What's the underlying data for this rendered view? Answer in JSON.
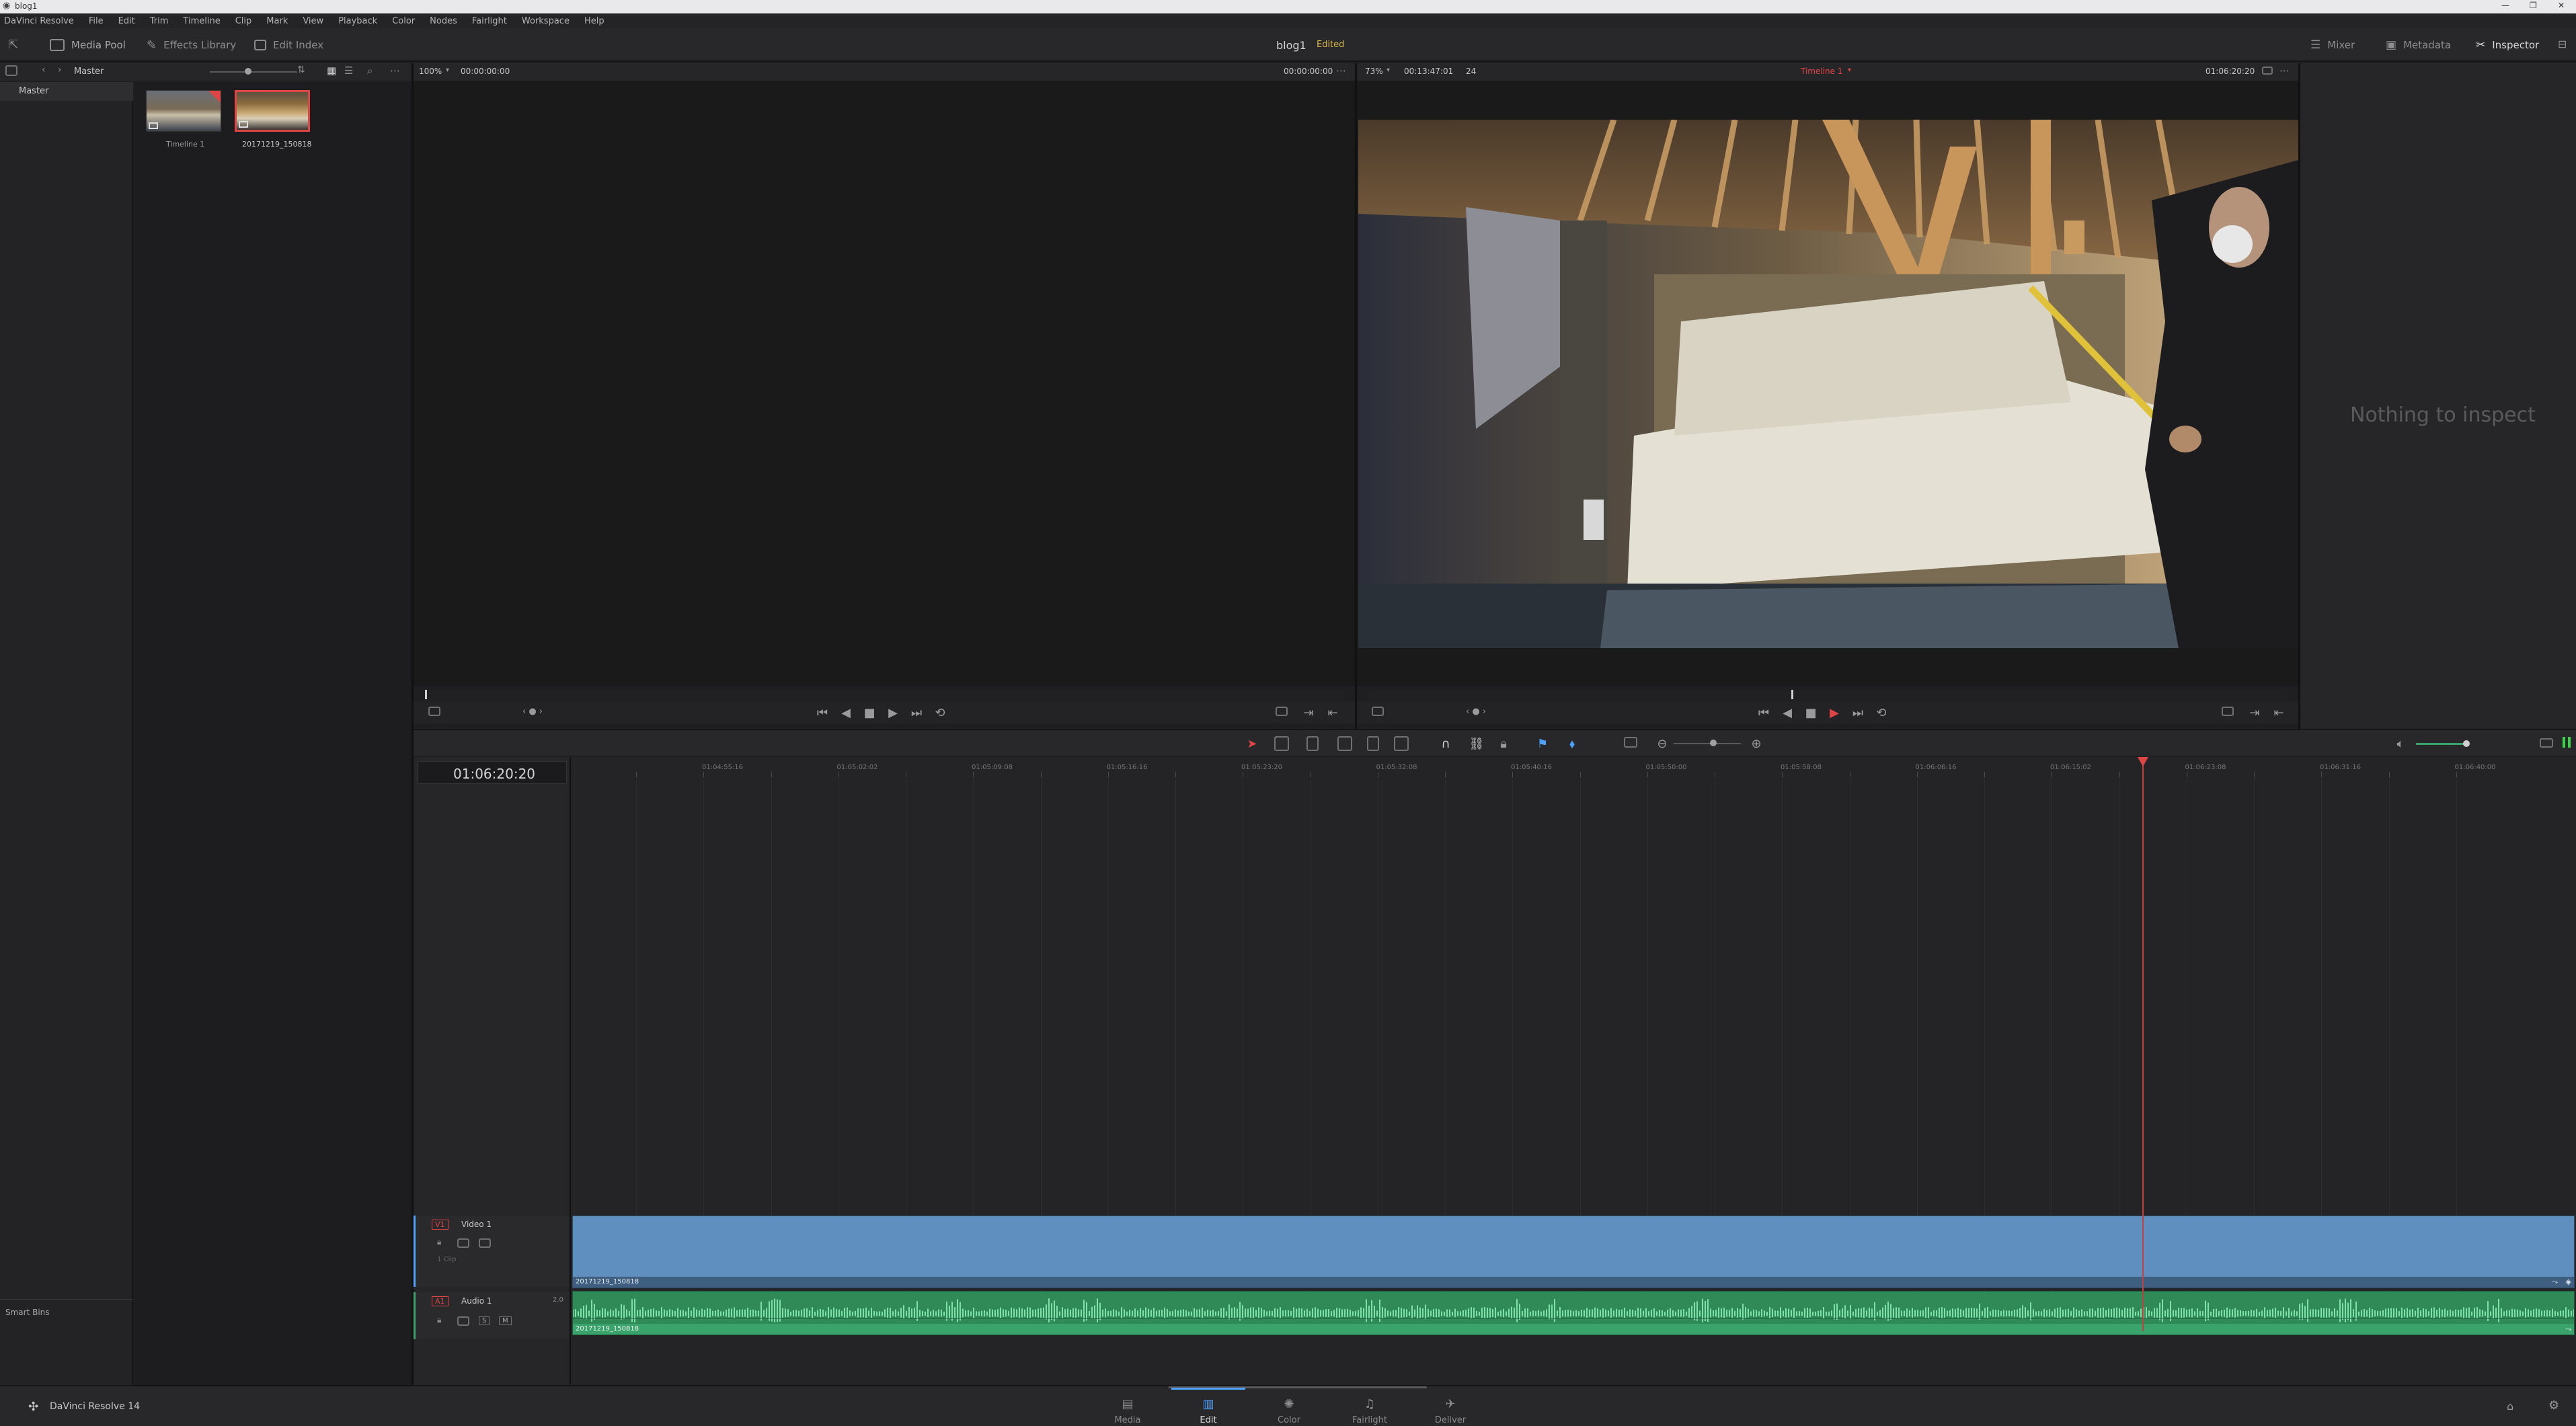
{
  "window": {
    "title": "blog1",
    "controls": [
      "—",
      "❐",
      "✕"
    ]
  },
  "menu": [
    "DaVinci Resolve",
    "File",
    "Edit",
    "Trim",
    "Timeline",
    "Clip",
    "Mark",
    "View",
    "Playback",
    "Color",
    "Nodes",
    "Fairlight",
    "Workspace",
    "Help"
  ],
  "toolbar": {
    "media_pool": "Media Pool",
    "effects_library": "Effects Library",
    "edit_index": "Edit Index",
    "project_name": "blog1",
    "project_status": "Edited",
    "mixer": "Mixer",
    "metadata": "Metadata",
    "inspector": "Inspector"
  },
  "media_pool": {
    "bin_label": "Master",
    "tree_root": "Master",
    "smart_bins": "Smart Bins",
    "clips": [
      {
        "name": "Timeline 1",
        "selected": false
      },
      {
        "name": "20171219_150818",
        "selected": true
      }
    ]
  },
  "source_viewer": {
    "zoom": "100%",
    "timecode": "00:00:00:00",
    "duration": "00:00:00:00"
  },
  "timeline_viewer": {
    "zoom": "73%",
    "duration": "00:13:47:01",
    "fps": "24",
    "timeline_name": "Timeline 1",
    "timecode": "01:06:20:20",
    "progress_fraction": 0.46
  },
  "inspector_panel": {
    "empty_text": "Nothing to inspect"
  },
  "timeline": {
    "current_timecode": "01:06:20:20",
    "ruler": [
      "01:04:55:16",
      "01:05:02:02",
      "01:05:09:08",
      "01:05:16:16",
      "01:05:23:20",
      "01:05:32:08",
      "01:05:40:16",
      "01:05:50:00",
      "01:05:58:08",
      "01:06:06:16",
      "01:06:15:02",
      "01:06:23:08",
      "01:06:31:16",
      "01:06:40:00"
    ],
    "playhead_fraction": 0.784,
    "tracks": {
      "video": {
        "id": "V1",
        "name": "Video 1",
        "clip_count": "1 Clip",
        "clip_name": "20171219_150818"
      },
      "audio": {
        "id": "A1",
        "name": "Audio 1",
        "channels": "2.0",
        "clip_name": "20171219_150818",
        "solo": "S",
        "mute": "M"
      }
    }
  },
  "pages": [
    {
      "label": "Media",
      "active": false
    },
    {
      "label": "Edit",
      "active": true
    },
    {
      "label": "Color",
      "active": false
    },
    {
      "label": "Fairlight",
      "active": false
    },
    {
      "label": "Deliver",
      "active": false
    }
  ],
  "footer": {
    "app_name": "DaVinci Resolve 14"
  },
  "colors": {
    "accent_red": "#e04545",
    "video_clip": "#5f8fbf",
    "audio_clip": "#3aa36b",
    "edited": "#d8b64a"
  }
}
